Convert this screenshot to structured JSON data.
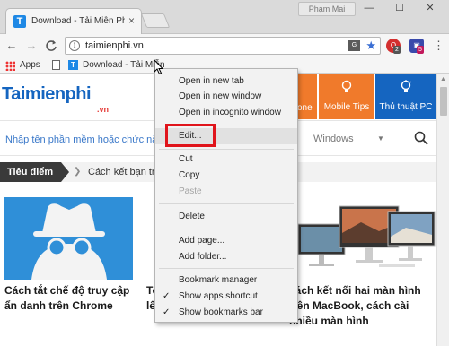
{
  "window": {
    "tab_title": "Download - Tải Miễn Phí",
    "tab_favicon_letter": "T",
    "user_name": "Phạm Mai",
    "controls": {
      "minimize": "—",
      "maximize": "☐",
      "close": "✕"
    }
  },
  "toolbar": {
    "back": "←",
    "forward": "→",
    "reload": "C",
    "url": "taimienphi.vn",
    "extensions": [
      {
        "badge": "2",
        "color": "#d32f2f"
      },
      {
        "badge": "5",
        "color": "#3949ab"
      }
    ]
  },
  "bookmarks_bar": {
    "apps_label": "Apps",
    "bookmark_label": "Download - Tải Miễn"
  },
  "site": {
    "logo": "Taimienphi",
    "logo_suffix": ".vn",
    "nav_partial": "one",
    "nav_items": [
      {
        "label": "Mobile Tips",
        "icon": "bulb-icon",
        "color": "#f07a2b"
      },
      {
        "label": "Thủ thuật PC",
        "icon": "bulb-icon",
        "color": "#1565c0"
      }
    ],
    "search_placeholder": "Nhập tên phần mềm hoặc chức năng",
    "search_filter": "Windows",
    "focus_label": "Tiêu điểm",
    "focus_text": "Cách kết bạn trê",
    "cards": [
      {
        "title_line1": "Cách tắt chế độ truy cập",
        "title_line2": "ẩn danh trên Chrome"
      },
      {
        "title_line1": "Tc",
        "title_line2": "lê"
      },
      {
        "title_line1": "cách kết nối hai màn hình",
        "title_line2": "trên MacBook, cách cài",
        "title_line3": "nhiều màn hình"
      }
    ]
  },
  "context_menu": {
    "items": [
      {
        "label": "Open in new tab",
        "disabled": false,
        "checked": false
      },
      {
        "label": "Open in new window",
        "disabled": false,
        "checked": false
      },
      {
        "label": "Open in incognito window",
        "disabled": false,
        "checked": false
      },
      {
        "label": "Edit...",
        "disabled": false,
        "checked": false,
        "highlighted": true
      },
      {
        "label": "Cut",
        "disabled": false,
        "checked": false
      },
      {
        "label": "Copy",
        "disabled": false,
        "checked": false
      },
      {
        "label": "Paste",
        "disabled": true,
        "checked": false
      },
      {
        "label": "Delete",
        "disabled": false,
        "checked": false
      },
      {
        "label": "Add page...",
        "disabled": false,
        "checked": false
      },
      {
        "label": "Add folder...",
        "disabled": false,
        "checked": false
      },
      {
        "label": "Bookmark manager",
        "disabled": false,
        "checked": false
      },
      {
        "label": "Show apps shortcut",
        "disabled": false,
        "checked": true
      },
      {
        "label": "Show bookmarks bar",
        "disabled": false,
        "checked": true
      }
    ],
    "check_glyph": "✓"
  },
  "colors": {
    "highlight_box": "#e0141b",
    "brand_blue": "#1565c0",
    "brand_orange": "#f07a2b"
  }
}
